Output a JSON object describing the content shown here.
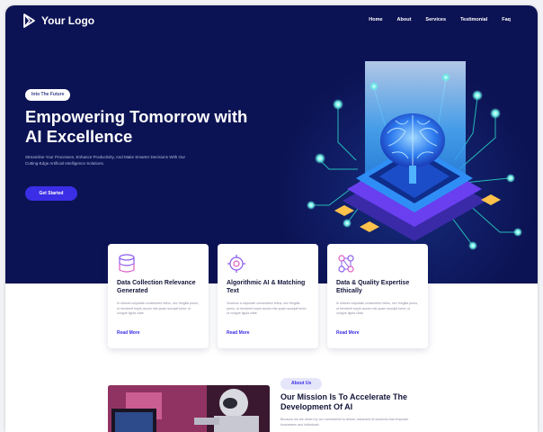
{
  "brand": {
    "logo_text": "Your Logo",
    "accent": "#3b2ee6",
    "hero_bg": "#0c1354"
  },
  "nav": {
    "items": [
      "Home",
      "About",
      "Services",
      "Testimonial",
      "Faq"
    ]
  },
  "hero": {
    "badge": "Into The Future",
    "title": "Empowering Tomorrow with AI Excellence",
    "description": "Streamline Your Processes, Enhance Productivity, And Make Smarter Decisions With Our Cutting-Edge Artificial Intelligence Solutions.",
    "cta_label": "Get Started",
    "illustration_icon": "ai-brain-chip-icon"
  },
  "features": [
    {
      "title": "Data Collection Relevance Generated",
      "text": "In ultrices vulputate consectetur tellus, nec fringilla purus, ut hendrerit turpis auctor nisi quam suscipit tortor ut congue ligula vitae.",
      "link": "Read More",
      "icon": "data-collection-icon"
    },
    {
      "title": "Algorithmic AI & Matching Text",
      "text": "Vivamus a vulputate consectetur tellus, nec fringilla purus, ut hendrerit turpis auctor nisi quam suscipit tortor ut congue ligula vitae.",
      "link": "Read More",
      "icon": "ai-algorithm-icon"
    },
    {
      "title": "Data & Quality Expertise Ethically",
      "text": "In ultrices vulputate consectetur tellus, nec fringilla purus, ut hendrerit turpis auctor nisi quam suscipit tortor ut congue ligula vitae.",
      "link": "Read More",
      "icon": "data-quality-icon"
    }
  ],
  "about": {
    "badge": "About Us",
    "title": "Our Mission Is To Accelerate The Development Of AI",
    "text": "Because we are driven by our commitment to deliver advanced AI solutions that empower businesses and individuals",
    "image_icon": "robot-photo-icon"
  }
}
